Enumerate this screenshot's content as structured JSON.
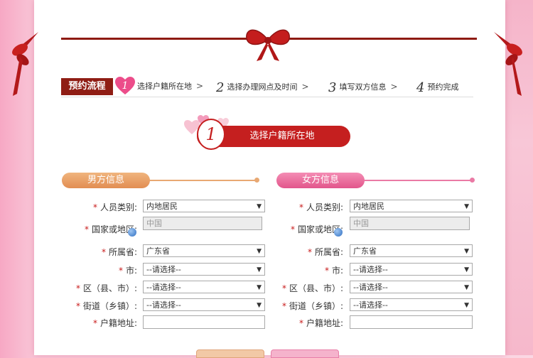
{
  "steps": {
    "label": "预约流程",
    "items": [
      {
        "num": "1",
        "text": "选择户籍所在地"
      },
      {
        "num": "2",
        "text": "选择办理网点及时间"
      },
      {
        "num": "3",
        "text": "填写双方信息"
      },
      {
        "num": "4",
        "text": "预约完成"
      }
    ],
    "arrow": ">"
  },
  "current_step": {
    "num": "1",
    "text": "选择户籍所在地"
  },
  "male": {
    "heading": "男方信息",
    "fields": {
      "person_type": {
        "label": "人员类别:",
        "value": "内地居民"
      },
      "country": {
        "label": "国家或地区:",
        "value": "中国"
      },
      "province": {
        "label": "所属省:",
        "value": "广东省"
      },
      "city": {
        "label": "市:",
        "value": "--请选择--"
      },
      "district": {
        "label": "区（县、市）:",
        "value": "--请选择--"
      },
      "street": {
        "label": "街道（乡镇）:",
        "value": "--请选择--"
      },
      "address": {
        "label": "户籍地址:",
        "value": ""
      }
    }
  },
  "female": {
    "heading": "女方信息",
    "fields": {
      "person_type": {
        "label": "人员类别:",
        "value": "内地居民"
      },
      "country": {
        "label": "国家或地区:",
        "value": "中国"
      },
      "province": {
        "label": "所属省:",
        "value": "广东省"
      },
      "city": {
        "label": "市:",
        "value": "--请选择--"
      },
      "district": {
        "label": "区（县、市）:",
        "value": "--请选择--"
      },
      "street": {
        "label": "街道（乡镇）:",
        "value": "--请选择--"
      },
      "address": {
        "label": "户籍地址:",
        "value": ""
      }
    }
  },
  "required_mark": "*",
  "caret": "▼",
  "colors": {
    "ribbon": "#8f1d14",
    "accent_red": "#c51f1f",
    "male": "#e28d52",
    "female": "#e2558b"
  }
}
